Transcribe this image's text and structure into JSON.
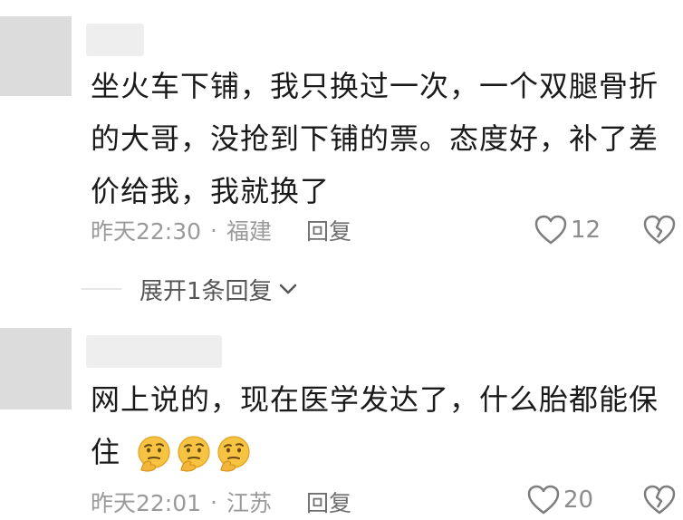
{
  "comments": [
    {
      "text": "坐火车下铺，我只换过一次，一个双腿骨折的大哥，没抢到下铺的票。态度好，补了差价给我，我就换了",
      "time": "昨天22:30",
      "separator": "·",
      "location": "福建",
      "reply_label": "回复",
      "like_count": "12",
      "expand_label": "展开1条回复"
    },
    {
      "text": "网上说的，现在医学发达了，什么胎都能保住",
      "time": "昨天22:01",
      "separator": "·",
      "location": "江苏",
      "reply_label": "回复",
      "like_count": "20",
      "emojis": [
        "thinking-emoji",
        "thinking-emoji",
        "thinking-emoji"
      ]
    }
  ],
  "icons": [
    "heart-icon",
    "broken-heart-icon",
    "chevron-down-icon"
  ],
  "colors": {
    "text": "#1a1a1a",
    "meta": "#9a9a9a",
    "avatar_placeholder": "#dcdcdc",
    "emoji_face": "#f6c343"
  }
}
